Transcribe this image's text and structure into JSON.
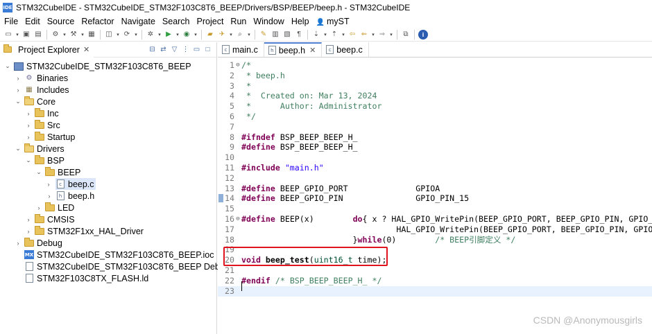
{
  "window": {
    "app_icon_text": "IDE",
    "title": "STM32CubeIDE - STM32CubeIDE_STM32F103C8T6_BEEP/Drivers/BSP/BEEP/beep.h - STM32CubeIDE"
  },
  "menu": [
    "File",
    "Edit",
    "Source",
    "Refactor",
    "Navigate",
    "Search",
    "Project",
    "Run",
    "Window",
    "Help",
    "myST"
  ],
  "toolbar_icons": [
    "new-icon",
    "save-icon",
    "save-all-icon",
    "build-icon",
    "hammer-icon",
    "debug-config-icon",
    "run-icon",
    "debug-icon",
    "external-tools-icon",
    "search-icon",
    "info-icon"
  ],
  "left_panel": {
    "tab_label": "Project Explorer",
    "tree": [
      {
        "label": "STM32CubeIDE_STM32F103C8T6_BEEP",
        "level": 0,
        "chev": "v",
        "icon": "project"
      },
      {
        "label": "Binaries",
        "level": 1,
        "chev": ">",
        "icon": "binaries"
      },
      {
        "label": "Includes",
        "level": 1,
        "chev": ">",
        "icon": "includes"
      },
      {
        "label": "Core",
        "level": 1,
        "chev": "v",
        "icon": "srcfolder"
      },
      {
        "label": "Inc",
        "level": 2,
        "chev": ">",
        "icon": "folder"
      },
      {
        "label": "Src",
        "level": 2,
        "chev": ">",
        "icon": "folder"
      },
      {
        "label": "Startup",
        "level": 2,
        "chev": ">",
        "icon": "folder"
      },
      {
        "label": "Drivers",
        "level": 1,
        "chev": "v",
        "icon": "srcfolder"
      },
      {
        "label": "BSP",
        "level": 2,
        "chev": "v",
        "icon": "folder"
      },
      {
        "label": "BEEP",
        "level": 3,
        "chev": "v",
        "icon": "folder"
      },
      {
        "label": "beep.c",
        "level": 4,
        "chev": ">",
        "icon": "cfile",
        "selected": true
      },
      {
        "label": "beep.h",
        "level": 4,
        "chev": ">",
        "icon": "hfile"
      },
      {
        "label": "LED",
        "level": 3,
        "chev": ">",
        "icon": "folder"
      },
      {
        "label": "CMSIS",
        "level": 2,
        "chev": ">",
        "icon": "folder"
      },
      {
        "label": "STM32F1xx_HAL_Driver",
        "level": 2,
        "chev": ">",
        "icon": "folder"
      },
      {
        "label": "Debug",
        "level": 1,
        "chev": ">",
        "icon": "folder"
      },
      {
        "label": "STM32CubeIDE_STM32F103C8T6_BEEP.ioc",
        "level": 1,
        "chev": "",
        "icon": "mx"
      },
      {
        "label": "STM32CubeIDE_STM32F103C8T6_BEEP Debug.lau",
        "level": 1,
        "chev": "",
        "icon": "file"
      },
      {
        "label": "STM32F103C8TX_FLASH.ld",
        "level": 1,
        "chev": "",
        "icon": "file"
      }
    ]
  },
  "editor": {
    "tabs": [
      {
        "label": "main.c",
        "active": false,
        "closable": false
      },
      {
        "label": "beep.h",
        "active": true,
        "closable": true
      },
      {
        "label": "beep.c",
        "active": false,
        "closable": false
      }
    ],
    "lines": [
      {
        "n": "1",
        "fold": "⊖",
        "html": "<span class='cmt'>/*</span>"
      },
      {
        "n": "2",
        "html": "<span class='cmt'> * beep.h</span>"
      },
      {
        "n": "3",
        "html": "<span class='cmt'> *</span>"
      },
      {
        "n": "4",
        "html": "<span class='cmt'> *  Created on: Mar 13, 2024</span>"
      },
      {
        "n": "5",
        "html": "<span class='cmt'> *      Author: Administrator</span>"
      },
      {
        "n": "6",
        "html": "<span class='cmt'> */</span>"
      },
      {
        "n": "7",
        "html": ""
      },
      {
        "n": "8",
        "html": "<span class='kw'>#ifndef</span> BSP_BEEP_BEEP_H_"
      },
      {
        "n": "9",
        "html": "<span class='kw'>#define</span> BSP_BEEP_BEEP_H_"
      },
      {
        "n": "10",
        "html": ""
      },
      {
        "n": "11",
        "html": "<span class='kw'>#include</span> <span class='str'>\"main.h\"</span>"
      },
      {
        "n": "12",
        "html": ""
      },
      {
        "n": "13",
        "html": "<span class='kw'>#define</span> BEEP_GPIO_PORT              GPIOA"
      },
      {
        "n": "14",
        "mark": true,
        "html": "<span class='kw'>#define</span> BEEP_GPIO_PIN               GPIO_PIN_15"
      },
      {
        "n": "15",
        "html": ""
      },
      {
        "n": "16",
        "fold": "⊖",
        "html": "<span class='kw'>#define</span> BEEP(x)        <span class='kw'>do</span>{ x ? HAL_GPIO_WritePin(BEEP_GPIO_PORT, BEEP_GPIO_PIN, GPIO_P"
      },
      {
        "n": "17",
        "html": "                                HAL_GPIO_WritePin(BEEP_GPIO_PORT, BEEP_GPIO_PIN, GPIO_P"
      },
      {
        "n": "18",
        "html": "                       }<span class='kw'>while</span>(0)        <span class='cmt'>/* BEEP引脚定义 */</span>"
      },
      {
        "n": "19",
        "html": ""
      },
      {
        "n": "20",
        "html": "<span class='kw'>void</span> <span class='fn'>beep_test</span>(<span class='ty'>uint16_t</span> time);"
      },
      {
        "n": "21",
        "html": ""
      },
      {
        "n": "22",
        "html": "<span class='kw'>#endif</span> <span class='cmt'>/* BSP_BEEP_BEEP_H_ */</span>"
      },
      {
        "n": "23",
        "current": true,
        "html": ""
      }
    ]
  },
  "watermark": "CSDN @Anonymousgirls"
}
